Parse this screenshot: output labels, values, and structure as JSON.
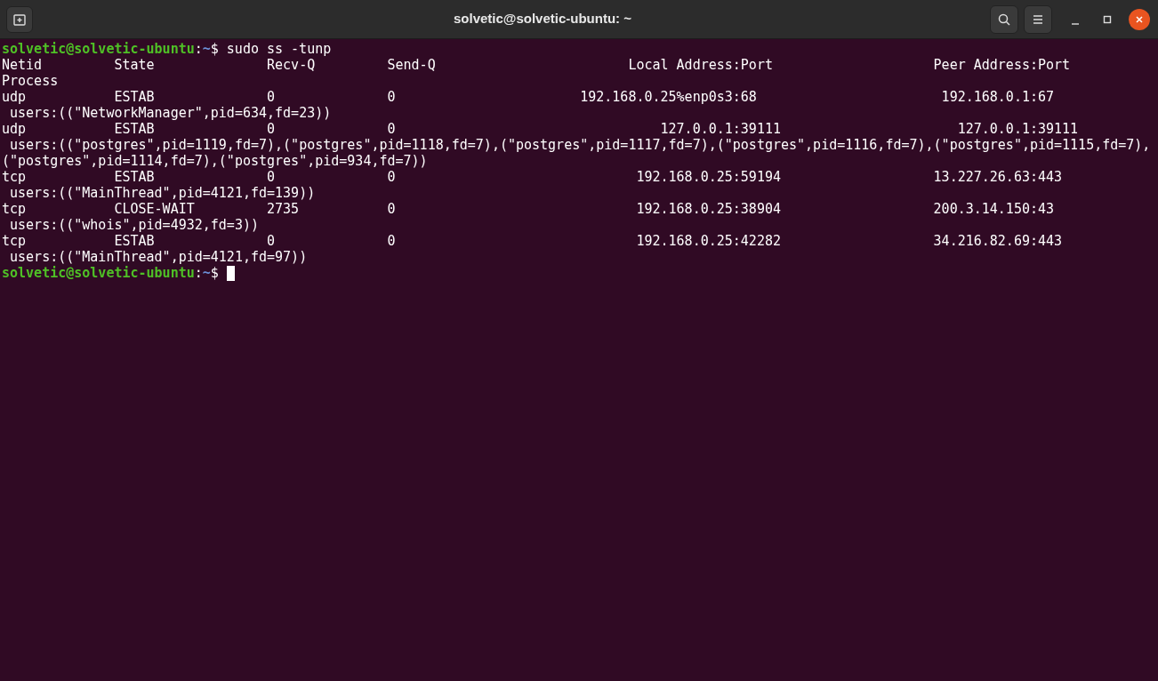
{
  "window": {
    "title": "solvetic@solvetic-ubuntu: ~"
  },
  "terminal": {
    "lines": [
      {
        "kind": "prompt",
        "user_host": "solvetic@solvetic-ubuntu",
        "separator": ":",
        "path": "~",
        "symbol": "$",
        "command": "sudo ss -tunp",
        "cursor": false
      },
      {
        "kind": "output",
        "text": "Netid         State              Recv-Q         Send-Q                        Local Address:Port                    Peer Address:Port"
      },
      {
        "kind": "output",
        "text": "Process"
      },
      {
        "kind": "output",
        "text": "udp           ESTAB              0              0                       192.168.0.25%enp0s3:68                       192.168.0.1:67"
      },
      {
        "kind": "output",
        "text": " users:((\"NetworkManager\",pid=634,fd=23))"
      },
      {
        "kind": "output",
        "text": "udp           ESTAB              0              0                                 127.0.0.1:39111                      127.0.0.1:39111"
      },
      {
        "kind": "output",
        "text": " users:((\"postgres\",pid=1119,fd=7),(\"postgres\",pid=1118,fd=7),(\"postgres\",pid=1117,fd=7),(\"postgres\",pid=1116,fd=7),(\"postgres\",pid=1115,fd=7),"
      },
      {
        "kind": "output",
        "text": "(\"postgres\",pid=1114,fd=7),(\"postgres\",pid=934,fd=7))"
      },
      {
        "kind": "output",
        "text": "tcp           ESTAB              0              0                              192.168.0.25:59194                   13.227.26.63:443"
      },
      {
        "kind": "output",
        "text": " users:((\"MainThread\",pid=4121,fd=139))"
      },
      {
        "kind": "output",
        "text": "tcp           CLOSE-WAIT         2735           0                              192.168.0.25:38904                   200.3.14.150:43"
      },
      {
        "kind": "output",
        "text": " users:((\"whois\",pid=4932,fd=3))"
      },
      {
        "kind": "output",
        "text": "tcp           ESTAB              0              0                              192.168.0.25:42282                   34.216.82.69:443"
      },
      {
        "kind": "output",
        "text": " users:((\"MainThread\",pid=4121,fd=97))"
      },
      {
        "kind": "prompt",
        "user_host": "solvetic@solvetic-ubuntu",
        "separator": ":",
        "path": "~",
        "symbol": "$",
        "cursor": true
      }
    ]
  }
}
